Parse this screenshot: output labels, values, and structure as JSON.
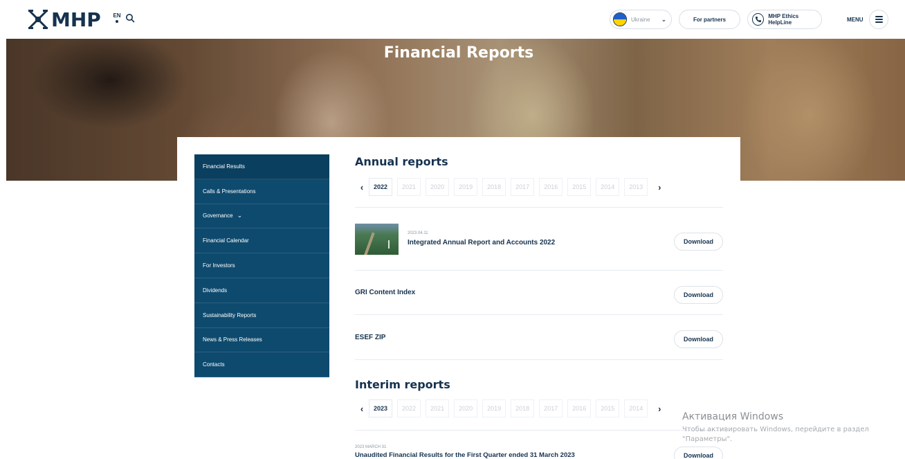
{
  "header": {
    "logo_text": "MHP",
    "lang": "EN",
    "country": "Ukraine",
    "partners": "For partners",
    "helpline": "MHP Ethics HelpLine",
    "menu": "MENU"
  },
  "hero": {
    "title": "Financial Reports"
  },
  "sidebar": {
    "items": [
      {
        "label": "Financial Results"
      },
      {
        "label": "Calls & Presentations"
      },
      {
        "label": "Governance"
      },
      {
        "label": "Financial Calendar"
      },
      {
        "label": "For Investors"
      },
      {
        "label": "Dividends"
      },
      {
        "label": "Sustainability Reports"
      },
      {
        "label": "News & Press Releases"
      },
      {
        "label": "Contacts"
      }
    ]
  },
  "annual": {
    "title": "Annual reports",
    "years": [
      "2022",
      "2021",
      "2020",
      "2019",
      "2018",
      "2017",
      "2016",
      "2015",
      "2014",
      "2013"
    ],
    "reports": [
      {
        "date": "2023.04.11",
        "name": "Integrated Annual Report and Accounts 2022",
        "action": "Download"
      },
      {
        "date": "",
        "name": "GRI Content Index",
        "action": "Download"
      },
      {
        "date": "",
        "name": "ESEF ZIP",
        "action": "Download"
      }
    ]
  },
  "interim": {
    "title": "Interim reports",
    "years": [
      "2023",
      "2022",
      "2021",
      "2020",
      "2019",
      "2018",
      "2017",
      "2016",
      "2015",
      "2014"
    ],
    "reports": [
      {
        "date": "2023 MARCH 31",
        "name": "Unaudited Financial Results for the First Quarter ended 31 March 2023",
        "action": "Download"
      }
    ]
  },
  "watermark": {
    "title": "Активация Windows",
    "subtitle": "Чтобы активировать Windows, перейдите в раздел \"Параметры\"."
  }
}
